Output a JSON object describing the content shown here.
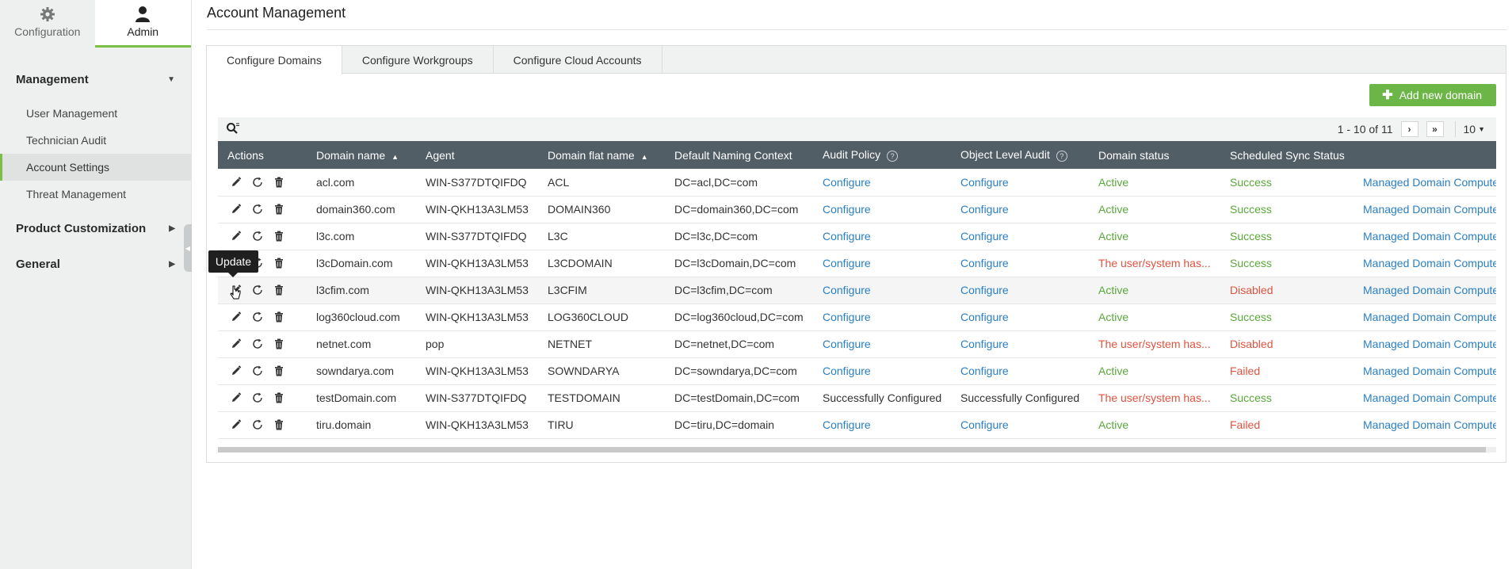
{
  "sidebar": {
    "top_tabs": [
      {
        "label": "Configuration",
        "icon": "gear-icon"
      },
      {
        "label": "Admin",
        "icon": "user-icon"
      }
    ],
    "sections": [
      {
        "label": "Management",
        "expanded": true,
        "items": [
          {
            "label": "User Management"
          },
          {
            "label": "Technician Audit"
          },
          {
            "label": "Account Settings",
            "active": true
          },
          {
            "label": "Threat Management"
          }
        ]
      },
      {
        "label": "Product Customization",
        "expanded": false
      },
      {
        "label": "General",
        "expanded": false
      }
    ]
  },
  "page": {
    "title": "Account Management",
    "tabs": [
      {
        "label": "Configure Domains",
        "active": true
      },
      {
        "label": "Configure Workgroups"
      },
      {
        "label": "Configure Cloud Accounts"
      }
    ],
    "add_button": "Add new domain",
    "pager": {
      "range": "1 - 10 of 11",
      "page_size": "10"
    },
    "tooltip": "Update"
  },
  "table": {
    "columns": [
      "Actions",
      "Domain name",
      "Agent",
      "Domain flat name",
      "Default Naming Context",
      "Audit Policy",
      "Object Level Audit",
      "Domain status",
      "Scheduled Sync Status",
      ""
    ],
    "rows": [
      {
        "domain": "acl.com",
        "agent": "WIN-S377DTQIFDQ",
        "flat": "ACL",
        "dnc": "DC=acl,DC=com",
        "audit": "Configure",
        "ola": "Configure",
        "status": "Active",
        "sync": "Success",
        "extra": "Managed Domain Computers"
      },
      {
        "domain": "domain360.com",
        "agent": "WIN-QKH13A3LM53",
        "flat": "DOMAIN360",
        "dnc": "DC=domain360,DC=com",
        "audit": "Configure",
        "ola": "Configure",
        "status": "Active",
        "sync": "Success",
        "extra": "Managed Domain Computers"
      },
      {
        "domain": "l3c.com",
        "agent": "WIN-S377DTQIFDQ",
        "flat": "L3C",
        "dnc": "DC=l3c,DC=com",
        "audit": "Configure",
        "ola": "Configure",
        "status": "Active",
        "sync": "Success",
        "extra": "Managed Domain Computers"
      },
      {
        "domain": "l3cDomain.com",
        "agent": "WIN-QKH13A3LM53",
        "flat": "L3CDOMAIN",
        "dnc": "DC=l3cDomain,DC=com",
        "audit": "Configure",
        "ola": "Configure",
        "status": "The user/system has...",
        "sync": "Success",
        "extra": "Managed Domain Computers"
      },
      {
        "domain": "l3cfim.com",
        "agent": "WIN-QKH13A3LM53",
        "flat": "L3CFIM",
        "dnc": "DC=l3cfim,DC=com",
        "audit": "Configure",
        "ola": "Configure",
        "status": "Active",
        "sync": "Disabled",
        "extra": "Managed Domain Computers"
      },
      {
        "domain": "log360cloud.com",
        "agent": "WIN-QKH13A3LM53",
        "flat": "LOG360CLOUD",
        "dnc": "DC=log360cloud,DC=com",
        "audit": "Configure",
        "ola": "Configure",
        "status": "Active",
        "sync": "Success",
        "extra": "Managed Domain Computers"
      },
      {
        "domain": "netnet.com",
        "agent": "pop",
        "flat": "NETNET",
        "dnc": "DC=netnet,DC=com",
        "audit": "Configure",
        "ola": "Configure",
        "status": "The user/system has...",
        "sync": "Disabled",
        "extra": "Managed Domain Computers"
      },
      {
        "domain": "sowndarya.com",
        "agent": "WIN-QKH13A3LM53",
        "flat": "SOWNDARYA",
        "dnc": "DC=sowndarya,DC=com",
        "audit": "Configure",
        "ola": "Configure",
        "status": "Active",
        "sync": "Failed",
        "extra": "Managed Domain Computers"
      },
      {
        "domain": "testDomain.com",
        "agent": "WIN-S377DTQIFDQ",
        "flat": "TESTDOMAIN",
        "dnc": "DC=testDomain,DC=com",
        "audit": "Successfully Configured",
        "ola": "Successfully Configured",
        "status": "The user/system has...",
        "sync": "Success",
        "extra": "Managed Domain Computers"
      },
      {
        "domain": "tiru.domain",
        "agent": "WIN-QKH13A3LM53",
        "flat": "TIRU",
        "dnc": "DC=tiru,DC=domain",
        "audit": "Configure",
        "ola": "Configure",
        "status": "Active",
        "sync": "Failed",
        "extra": "Managed Domain Computers"
      }
    ]
  },
  "colors": {
    "accent": "#7bbf44",
    "header": "#525e66",
    "link": "#2a7fc4",
    "ok": "#5aa83a",
    "error": "#e0533f"
  }
}
